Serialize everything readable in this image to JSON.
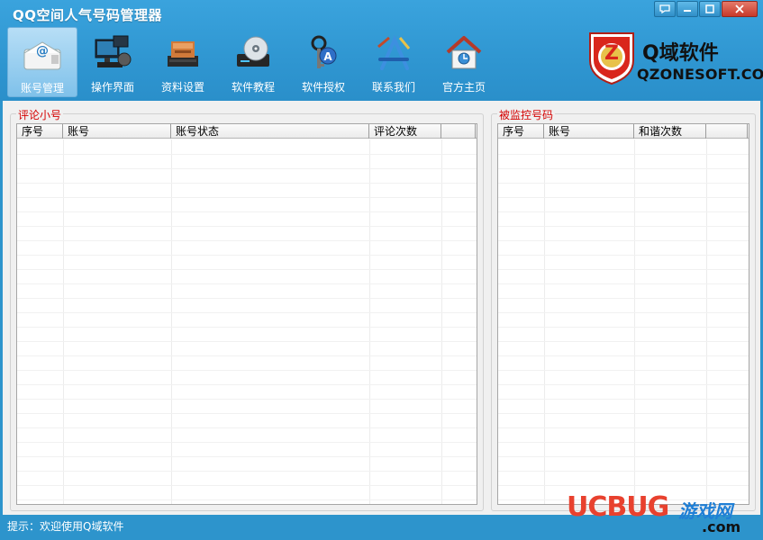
{
  "window": {
    "title": "QQ空间人气号码管理器",
    "controls": [
      "chat-icon",
      "minimize-icon",
      "maximize-icon",
      "close-icon"
    ]
  },
  "toolbar": {
    "items": [
      {
        "label": "账号管理",
        "icon": "at-mail-icon",
        "active": true
      },
      {
        "label": "操作界面",
        "icon": "monitor-icon",
        "active": false
      },
      {
        "label": "资料设置",
        "icon": "storage-icon",
        "active": false
      },
      {
        "label": "软件教程",
        "icon": "disc-drive-icon",
        "active": false
      },
      {
        "label": "软件授权",
        "icon": "keys-icon",
        "active": false
      },
      {
        "label": "联系我们",
        "icon": "app-store-icon",
        "active": false
      },
      {
        "label": "官方主页",
        "icon": "home-icon",
        "active": false
      }
    ]
  },
  "brand": {
    "logo_letter": "Z",
    "name": "Q域软件",
    "url": "QZONESOFT.COM"
  },
  "comment_accounts": {
    "title": "评论小号",
    "columns": [
      "序号",
      "账号",
      "账号状态",
      "评论次数",
      ""
    ],
    "rows": []
  },
  "monitored_numbers": {
    "title": "被监控号码",
    "columns": [
      "序号",
      "账号",
      "和谐次数",
      ""
    ],
    "rows": []
  },
  "status": {
    "text": "提示：欢迎使用Q域软件"
  },
  "watermark": {
    "main": "UCBUG",
    "sub": "游戏网",
    "domain": ".com"
  },
  "colors": {
    "header_blue": "#2f96d1",
    "group_title_red": "#d40000",
    "brand_red": "#d9261c",
    "watermark_red": "#e8412e",
    "watermark_blue": "#1f7fd6"
  }
}
